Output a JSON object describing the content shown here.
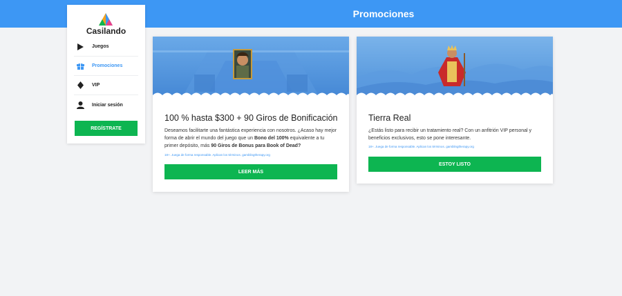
{
  "header": {
    "title": "Promociones"
  },
  "brand": {
    "name": "Casilando"
  },
  "sidebar": {
    "items": [
      {
        "label": "Juegos",
        "icon": "play-icon"
      },
      {
        "label": "Promociones",
        "icon": "gift-icon",
        "active": true
      },
      {
        "label": "VIP",
        "icon": "diamond-icon"
      },
      {
        "label": "Iniciar sesión",
        "icon": "user-icon"
      }
    ],
    "register_label": "REGÍSTRATE"
  },
  "promos": [
    {
      "title": "100 % hasta $300 + 90 Giros de Bonificación",
      "desc_1": "Deseamos facilitarte una fantástica experiencia con nosotros. ¿Acaso hay mejor forma de abrir el mundo del juego que un ",
      "desc_bold_1": "Bono del 100%",
      "desc_2": " equivalente a tu primer depósito, más ",
      "desc_bold_2": "90 Giros de Bonus para Book of Dead?",
      "terms": "18+. Juega de forma responsable. Aplican los términos. gamblingtherapy.org",
      "cta": "LEER MÁS"
    },
    {
      "title": "Tierra Real",
      "desc": "¿Estás listo para recibir un tratamiento real? Con un anfitrión VIP personal y beneficios exclusivos, esto se pone interesante.",
      "terms": "18+. Juega de forma responsable. Aplican los términos. gamblingtherapy.org",
      "cta": "ESTOY LISTO"
    }
  ],
  "colors": {
    "header": "#3d97f4",
    "accent": "#0db551",
    "link": "#3d97f4",
    "background": "#f2f3f5"
  }
}
